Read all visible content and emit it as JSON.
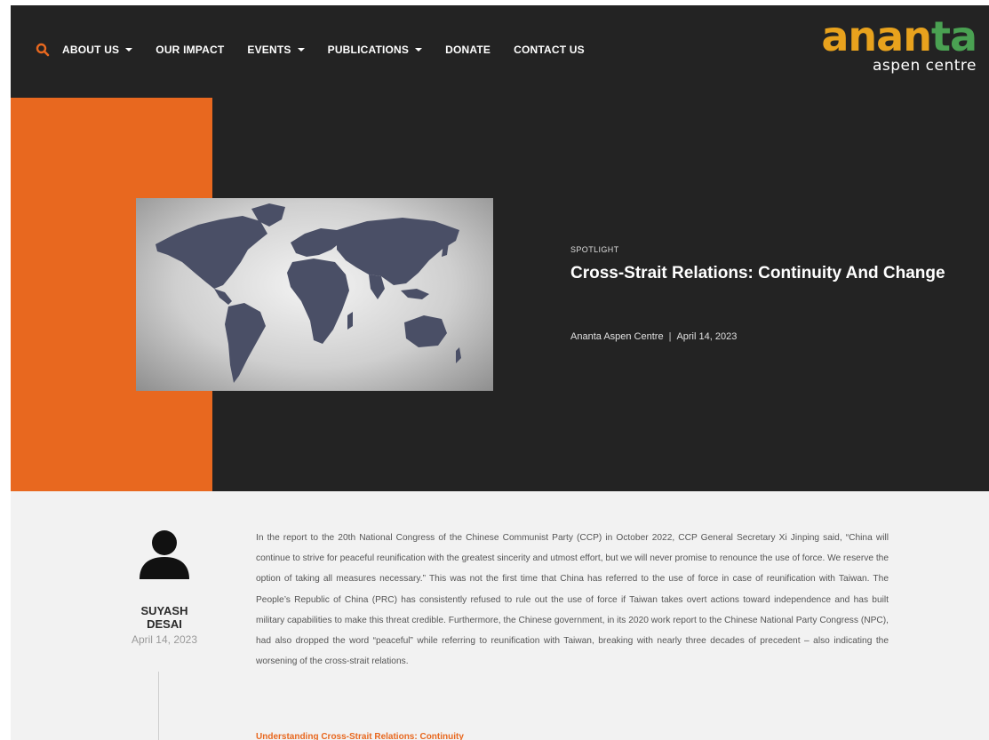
{
  "nav": {
    "items": [
      {
        "label": "ABOUT US",
        "dropdown": true
      },
      {
        "label": "OUR IMPACT",
        "dropdown": false
      },
      {
        "label": "EVENTS",
        "dropdown": true
      },
      {
        "label": "PUBLICATIONS",
        "dropdown": true
      },
      {
        "label": "DONATE",
        "dropdown": false
      },
      {
        "label": "CONTACT US",
        "dropdown": false
      }
    ]
  },
  "logo": {
    "main": "ananta",
    "sub": "aspen centre"
  },
  "hero": {
    "category": "SPOTLIGHT",
    "title": "Cross-Strait Relations: Continuity And Change",
    "publisher": "Ananta Aspen Centre",
    "separator": "|",
    "date": "April 14, 2023"
  },
  "author": {
    "first_name": "SUYASH",
    "last_name": "DESAI",
    "date": "April 14, 2023"
  },
  "article": {
    "paragraph": "In the report to the 20th National Congress of the Chinese Communist Party (CCP) in October 2022, CCP General Secretary Xi Jinping said, “China will continue to strive for peaceful reunification with the greatest sincerity and utmost effort, but we will never promise to renounce the use of force. We reserve the option of taking all measures necessary.” This was not the first time that China has referred to the use of force in case of reunification with Taiwan. The People’s Republic of China (PRC) has consistently refused to rule out the use of force if Taiwan takes overt actions toward independence and has built military capabilities to make this threat credible. Furthermore, the Chinese government, in its 2020 work report to the Chinese National Party Congress (NPC), had also dropped the word “peaceful” while referring to reunification with Taiwan, breaking with nearly three decades of precedent – also indicating the worsening of the cross-strait relations.",
    "subheading": "Understanding Cross-Strait Relations: Continuity"
  },
  "colors": {
    "accent": "#e8681f",
    "dark": "#232323",
    "logo_orange": "#e8a21d",
    "logo_green": "#4aa152",
    "map": "#4a4f66"
  }
}
